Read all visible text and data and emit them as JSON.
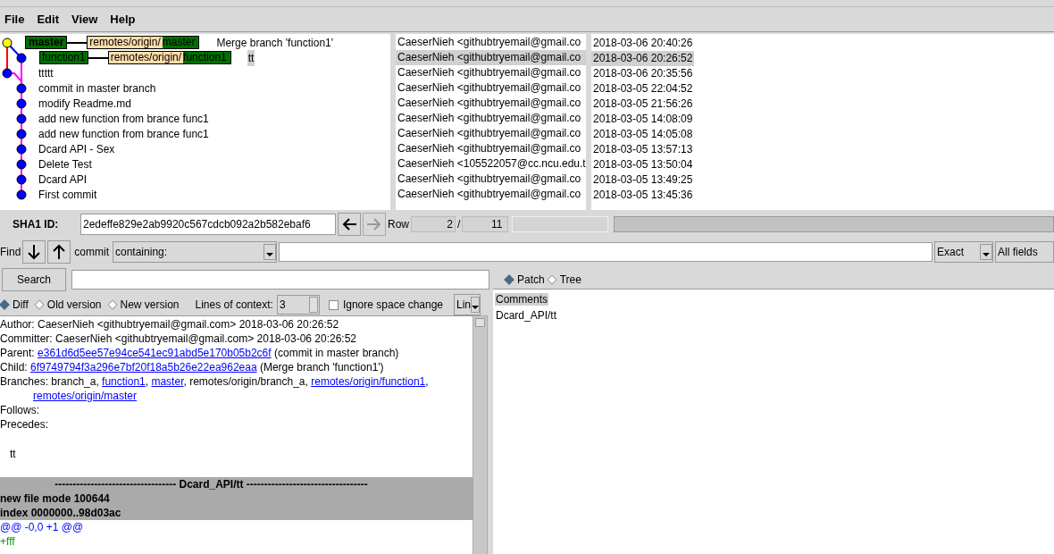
{
  "menu": [
    "File",
    "Edit",
    "View",
    "Help"
  ],
  "commits": [
    {
      "message": "Merge branch 'function1'",
      "author": "CaeserNieh <githubtryemail@gmail.co",
      "date": "2018-03-06 20:40:26",
      "selected": false,
      "refs": [
        {
          "kind": "head",
          "name": "master"
        },
        {
          "kind": "remote",
          "prefix": "remotes/origin/",
          "name": "master"
        }
      ]
    },
    {
      "message": "tt",
      "author": "CaeserNieh <githubtryemail@gmail.co",
      "date": "2018-03-06 20:26:52",
      "selected": true,
      "refs": [
        {
          "kind": "branch",
          "name": "function1"
        },
        {
          "kind": "remote",
          "prefix": "remotes/origin/",
          "name": "function1"
        }
      ]
    },
    {
      "message": "ttttt",
      "author": "CaeserNieh <githubtryemail@gmail.co",
      "date": "2018-03-06 20:35:56",
      "selected": false
    },
    {
      "message": "commit in master branch",
      "author": "CaeserNieh <githubtryemail@gmail.co",
      "date": "2018-03-05 22:04:52",
      "selected": false
    },
    {
      "message": "modify Readme.md",
      "author": "CaeserNieh <githubtryemail@gmail.co",
      "date": "2018-03-05 21:56:26",
      "selected": false
    },
    {
      "message": "add new function from brance func1",
      "author": "CaeserNieh <githubtryemail@gmail.co",
      "date": "2018-03-05 14:08:09",
      "selected": false
    },
    {
      "message": "add new function from brance func1",
      "author": "CaeserNieh <githubtryemail@gmail.co",
      "date": "2018-03-05 14:05:08",
      "selected": false
    },
    {
      "message": "Dcard API - Sex",
      "author": "CaeserNieh <githubtryemail@gmail.co",
      "date": "2018-03-05 13:57:13",
      "selected": false
    },
    {
      "message": "Delete Test",
      "author": "CaeserNieh <105522057@cc.ncu.edu.t",
      "date": "2018-03-05 13:50:04",
      "selected": false
    },
    {
      "message": "Dcard API",
      "author": "CaeserNieh <githubtryemail@gmail.co",
      "date": "2018-03-05 13:49:25",
      "selected": false
    },
    {
      "message": "First commit",
      "author": "CaeserNieh <githubtryemail@gmail.co",
      "date": "2018-03-05 13:45:36",
      "selected": false
    }
  ],
  "sha1": {
    "label": "SHA1 ID:",
    "value": "2edeffe829e2ab9920c567cdcb092a2b582ebaf6"
  },
  "row": {
    "label": "Row",
    "current": "2",
    "separator": "/",
    "total": "11"
  },
  "find": {
    "label": "Find",
    "type_label": "commit",
    "mode": "containing:",
    "match": "Exact",
    "fields": "All fields"
  },
  "search": {
    "button": "Search"
  },
  "view_modes": [
    {
      "label": "Patch",
      "selected": true
    },
    {
      "label": "Tree",
      "selected": false
    }
  ],
  "diff_modes": [
    {
      "label": "Diff",
      "selected": true
    },
    {
      "label": "Old version",
      "selected": false
    },
    {
      "label": "New version",
      "selected": false
    }
  ],
  "context": {
    "label": "Lines of context:",
    "value": "3"
  },
  "ignore_space": {
    "label": "Ignore space change",
    "checked": false
  },
  "line_mode": "Lin",
  "details": [
    [
      {
        "text": "Author: CaeserNieh <githubtryemail@gmail.com>  2018-03-06 20:26:52",
        "kind": "text"
      }
    ],
    [
      {
        "text": "Committer: CaeserNieh <githubtryemail@gmail.com>  2018-03-06 20:26:52",
        "kind": "text"
      }
    ],
    [
      {
        "text": "Parent: ",
        "kind": "text"
      },
      {
        "text": "e361d6d5ee57e94ce541ec91abd5e170b05b2c6f",
        "kind": "link"
      },
      {
        "text": " (commit in master branch)",
        "kind": "text"
      }
    ],
    [
      {
        "text": "Child:  ",
        "kind": "text"
      },
      {
        "text": "6f9749794f3a296e7bf20f18a5b26e22ea962eaa",
        "kind": "link"
      },
      {
        "text": " (Merge branch 'function1')",
        "kind": "text"
      }
    ],
    [
      {
        "text": "Branches: branch_a, ",
        "kind": "text"
      },
      {
        "text": "function1",
        "kind": "link"
      },
      {
        "text": ", ",
        "kind": "text"
      },
      {
        "text": "master",
        "kind": "link"
      },
      {
        "text": ", remotes/origin/branch_a, ",
        "kind": "text"
      },
      {
        "text": "remotes/origin/function1",
        "kind": "link"
      },
      {
        "text": ",",
        "kind": "text"
      }
    ],
    [
      {
        "text": "remotes/origin/master",
        "kind": "indent-link"
      }
    ],
    [
      {
        "text": "Follows:",
        "kind": "text"
      }
    ],
    [
      {
        "text": "Precedes:",
        "kind": "text"
      }
    ]
  ],
  "commit_message": "tt",
  "diff": [
    {
      "kind": "header",
      "text": "---------------------------------- Dcard_API/tt ----------------------------------"
    },
    {
      "kind": "header",
      "text": "new file mode 100644"
    },
    {
      "kind": "header",
      "text": "index 0000000..98d03ac"
    },
    {
      "kind": "hunk",
      "text": "@@ -0,0 +1 @@"
    },
    {
      "kind": "add",
      "text": "+fff"
    }
  ],
  "files": [
    {
      "name": "Comments",
      "selected": true
    },
    {
      "name": "Dcard_API/tt",
      "selected": false
    }
  ]
}
